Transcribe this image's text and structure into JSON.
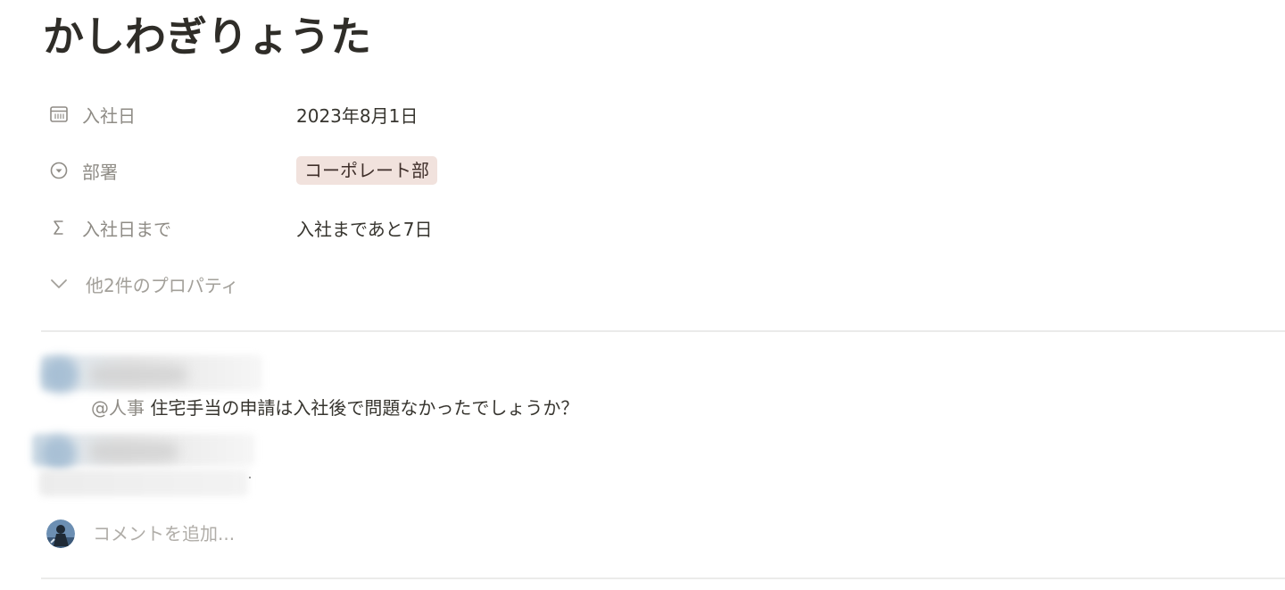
{
  "page": {
    "title": "かしわぎりょうた"
  },
  "properties": [
    {
      "icon": "calendar-icon",
      "label": "入社日",
      "value": "2023年8月1日"
    },
    {
      "icon": "select-icon",
      "label": "部署",
      "value": "コーポレート部",
      "tag_color": "#f1e2dd"
    },
    {
      "icon": "formula-sigma-icon",
      "label": "入社日まで",
      "value": "入社まであと7日"
    }
  ],
  "more_properties": {
    "icon": "chevron-down-icon",
    "label": "他2件のプロパティ"
  },
  "comments": [
    {
      "mention": "@人事",
      "text": " 住宅手当の申請は入社後で問題なかったでしょうか？"
    }
  ],
  "comment_input": {
    "placeholder": "コメントを追加..."
  },
  "colors": {
    "text": "#37352f",
    "muted": "#8f8c86",
    "tag_background": "#f1e2dd",
    "divider": "#ebebea"
  }
}
